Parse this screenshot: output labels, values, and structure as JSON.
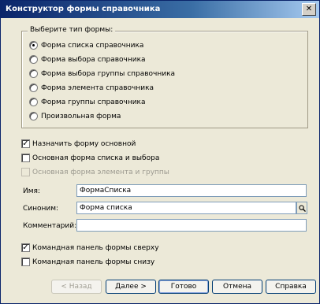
{
  "window": {
    "title": "Конструктор формы справочника"
  },
  "form_type": {
    "label": "Выберите тип формы:",
    "options": [
      {
        "label": "Форма списка справочника",
        "selected": true
      },
      {
        "label": "Форма выбора справочника",
        "selected": false
      },
      {
        "label": "Форма выбора группы справочника",
        "selected": false
      },
      {
        "label": "Форма элемента справочника",
        "selected": false
      },
      {
        "label": "Форма группы справочника",
        "selected": false
      },
      {
        "label": "Произвольная форма",
        "selected": false
      }
    ]
  },
  "options": {
    "main_form": {
      "label": "Назначить форму основной",
      "checked": true
    },
    "main_list_select": {
      "label": "Основная форма списка и выбора",
      "checked": false
    },
    "main_element_group": {
      "label": "Основная форма элемента и группы",
      "checked": false,
      "disabled": true
    }
  },
  "fields": {
    "name": {
      "label": "Имя:",
      "value": "ФормаСписка"
    },
    "synonym": {
      "label": "Синоним:",
      "value": "Форма списка"
    },
    "comment": {
      "label": "Комментарий:",
      "value": ""
    }
  },
  "panels": {
    "top": {
      "label": "Командная панель формы сверху",
      "checked": true
    },
    "bottom": {
      "label": "Командная панель формы снизу",
      "checked": false
    }
  },
  "buttons": {
    "back": "< Назад",
    "next": "Далее >",
    "finish": "Готово",
    "cancel": "Отмена",
    "help": "Справка"
  },
  "icons": {
    "close": "close-icon",
    "search": "search-icon"
  },
  "colors": {
    "titlebar": "#0a246a",
    "face": "#ece9d8"
  }
}
